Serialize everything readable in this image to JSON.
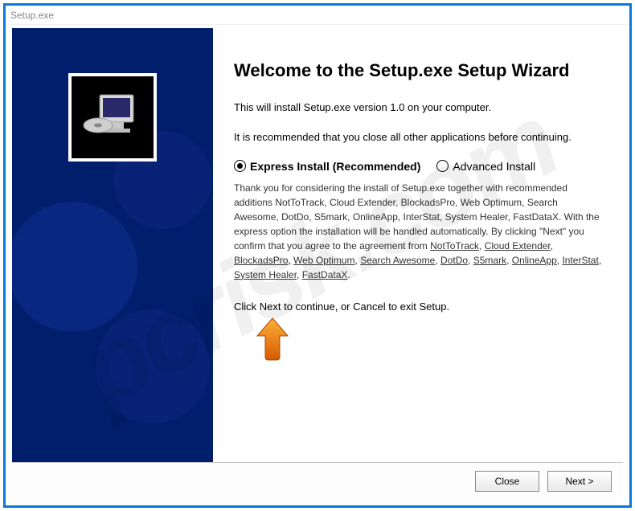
{
  "window": {
    "title": "Setup.exe"
  },
  "wizard": {
    "heading": "Welcome to the Setup.exe Setup Wizard",
    "intro": "This will install Setup.exe version 1.0 on your computer.",
    "recommend": "It is recommended that you close all other applications before continuing.",
    "radio_express": "Express Install (Recommended)",
    "radio_advanced": "Advanced Install",
    "thanks_prefix": "Thank you for considering the install of Setup.exe together with recommended additions NotToTrack, Cloud Extender, BlockadsPro, Web Optimum, Search Awesome, DotDo, S5mark, OnlineApp, InterStat, System Healer, FastDataX. With the express option the installation will be handled automatically. By clicking \"Next\" you confirm that you agree to the agreement from ",
    "links": {
      "nottotrack": "NotToTrack",
      "cloudextender": "Cloud Extender",
      "blockadspro": "BlockadsPro",
      "weboptimum": "Web Optimum",
      "searchawesome": "Search Awesome",
      "dotdo": "DotDo",
      "s5mark": "S5mark",
      "onlineapp": "OnlineApp",
      "interstat": "InterStat",
      "systemhealer": "System Healer",
      "fastdatax": "FastDataX"
    },
    "continue_text": "Click Next to continue, or Cancel to exit Setup."
  },
  "buttons": {
    "close": "Close",
    "next": "Next  >"
  },
  "watermark": "pcrisk.com"
}
